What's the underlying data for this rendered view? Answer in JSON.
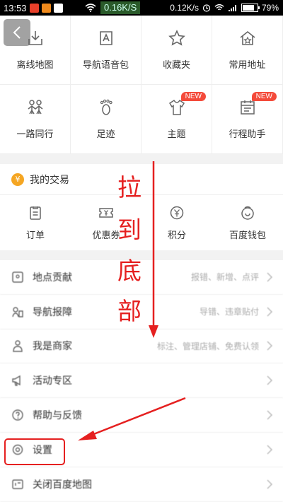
{
  "status_bar": {
    "time": "13:53",
    "speed_center": "0.16K/S",
    "speed_right": "0.12K/s",
    "battery": "79%"
  },
  "grid": {
    "items": [
      {
        "label": "离线地图",
        "icon": "download-map-icon"
      },
      {
        "label": "导航语音包",
        "icon": "voice-pack-icon"
      },
      {
        "label": "收藏夹",
        "icon": "star-icon"
      },
      {
        "label": "常用地址",
        "icon": "home-star-icon"
      },
      {
        "label": "一路同行",
        "icon": "people-icon"
      },
      {
        "label": "足迹",
        "icon": "footprint-icon"
      },
      {
        "label": "主题",
        "icon": "shirt-icon",
        "badge": "NEW"
      },
      {
        "label": "行程助手",
        "icon": "calendar-icon",
        "badge": "NEW"
      }
    ]
  },
  "trade": {
    "title": "我的交易",
    "yen": "¥",
    "items": [
      {
        "label": "订单"
      },
      {
        "label": "优惠券"
      },
      {
        "label": "积分"
      },
      {
        "label": "百度钱包"
      }
    ]
  },
  "list": {
    "items": [
      {
        "label": "地点贡献",
        "sub": "报错、新增、点评"
      },
      {
        "label": "导航报障",
        "sub": "导错、违章贴付"
      },
      {
        "label": "我是商家",
        "sub": "标注、管理店铺、免费认领"
      },
      {
        "label": "活动专区",
        "sub": ""
      },
      {
        "label": "帮助与反馈",
        "sub": ""
      },
      {
        "label": "设置",
        "sub": ""
      },
      {
        "label": "关闭百度地图",
        "sub": ""
      }
    ]
  },
  "annotation": {
    "chars": [
      "拉",
      "到",
      "底",
      "部"
    ],
    "color": "#e52020"
  },
  "colors": {
    "badge": "#f44a3a",
    "yen": "#f5a623"
  }
}
